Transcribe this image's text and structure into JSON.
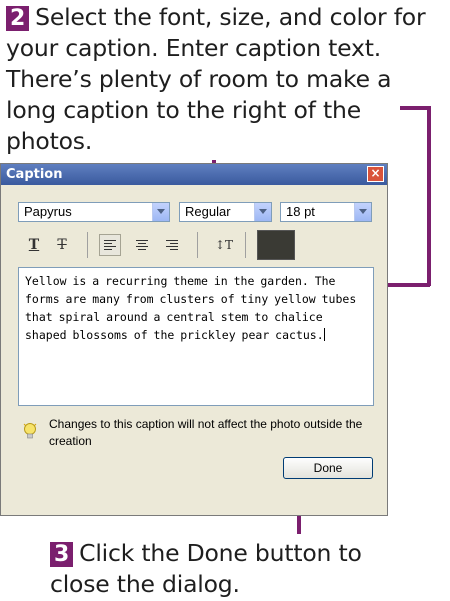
{
  "callouts": {
    "step2": {
      "number": "2",
      "text": "Select the font, size, and color for your caption. Enter caption text. There’s plenty of room to make a long caption to the right of the photos."
    },
    "step3": {
      "number": "3",
      "text": "Click the Done button to close the dialog."
    }
  },
  "dialog": {
    "title": "Caption",
    "close_icon": "×",
    "font": "Papyrus",
    "style": "Regular",
    "size": "18 pt",
    "toolbar": {
      "bold_icon": "T",
      "strike_icon": "T",
      "line_spacing_icon": "↕T",
      "color_value": "#3a3a34"
    },
    "caption_text": "Yellow is a recurring theme in the garden. The forms are many from clusters of tiny yellow tubes that spiral around a central stem to chalice shaped blossoms of the prickley pear cactus.",
    "info_text": "Changes to this caption will not affect the photo outside the creation",
    "done_label": "Done"
  },
  "colors": {
    "accent": "#7b1f6e",
    "titlebar": "#3a5a9e"
  }
}
